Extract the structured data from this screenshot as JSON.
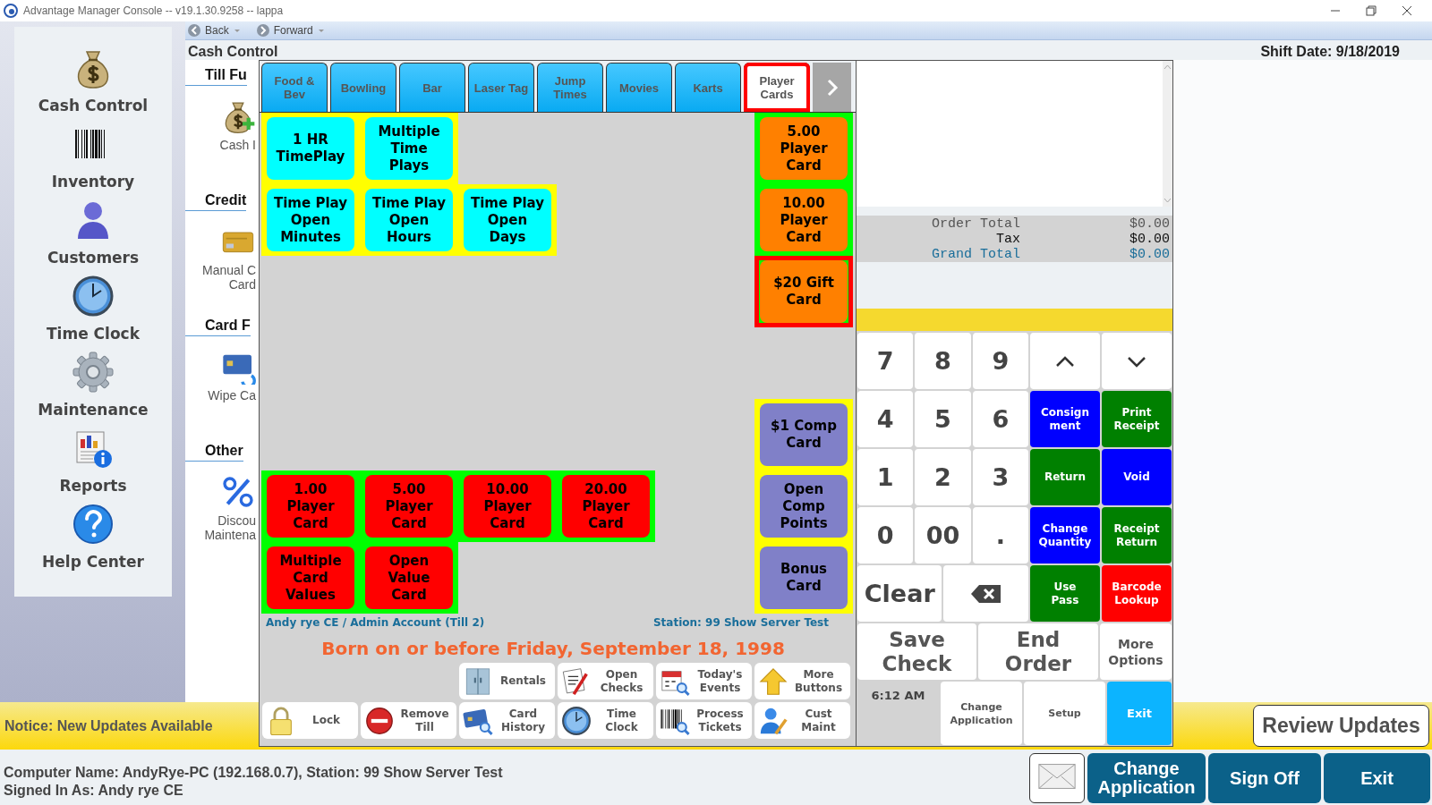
{
  "window": {
    "title": "Advantage Manager Console -- v19.1.30.9258 -- lappa"
  },
  "sidebar": {
    "items": [
      {
        "label": "Cash Control"
      },
      {
        "label": "Inventory"
      },
      {
        "label": "Customers"
      },
      {
        "label": "Time Clock"
      },
      {
        "label": "Maintenance"
      },
      {
        "label": "Reports"
      },
      {
        "label": "Help Center"
      }
    ]
  },
  "navigation": {
    "back": "Back",
    "forward": "Forward"
  },
  "page": {
    "title": "Cash Control",
    "shift_date": "Shift Date: 9/18/2019",
    "sections": [
      {
        "heading": "Till Fu",
        "items": [
          {
            "label": "Cash I"
          }
        ]
      },
      {
        "heading": "Credit",
        "items": [
          {
            "label": "Manual C\nCard"
          }
        ]
      },
      {
        "heading": "Card F",
        "items": [
          {
            "label": "Wipe Ca"
          }
        ]
      },
      {
        "heading": "Other",
        "items": [
          {
            "label": "Discou\nMaintena"
          }
        ]
      }
    ]
  },
  "pos": {
    "tabs": [
      {
        "label": "Food &\nBev",
        "selected": false
      },
      {
        "label": "Bowling",
        "selected": false
      },
      {
        "label": "Bar",
        "selected": false
      },
      {
        "label": "Laser Tag",
        "selected": false
      },
      {
        "label": "Jump\nTimes",
        "selected": false
      },
      {
        "label": "Movies",
        "selected": false
      },
      {
        "label": "Karts",
        "selected": false
      },
      {
        "label": "Player\nCards",
        "selected": true
      }
    ],
    "left_groups": [
      {
        "color": "#ffff00",
        "rows": [
          [
            {
              "label": "1 HR\nTimePlay",
              "color": "#00ffff",
              "outlined": false
            },
            {
              "label": "Multiple\nTime\nPlays",
              "color": "#00ffff",
              "outlined": false
            }
          ],
          [
            {
              "label": "Time Play\nOpen\nMinutes",
              "color": "#00ffff",
              "outlined": false
            },
            {
              "label": "Time Play\nOpen\nHours",
              "color": "#00ffff",
              "outlined": false
            },
            {
              "label": "Time Play\nOpen\nDays",
              "color": "#00ffff",
              "outlined": false
            }
          ]
        ]
      },
      {
        "color": "#00ff00",
        "rows": [
          [
            {
              "label": "1.00\nPlayer\nCard",
              "color": "#ff0000",
              "outlined": false
            },
            {
              "label": "5.00\nPlayer\nCard",
              "color": "#ff0000",
              "outlined": false
            },
            {
              "label": "10.00\nPlayer\nCard",
              "color": "#ff0000",
              "outlined": false
            },
            {
              "label": "20.00\nPlayer\nCard",
              "color": "#ff0000",
              "outlined": false
            }
          ],
          [
            {
              "label": "Multiple\nCard\nValues",
              "color": "#ff0000",
              "outlined": false
            },
            {
              "label": "Open\nValue\nCard",
              "color": "#ff0000",
              "outlined": false
            }
          ]
        ]
      }
    ],
    "right_groups": [
      {
        "color": "#00ff00",
        "buttons": [
          {
            "label": "5.00\nPlayer\nCard",
            "color": "#ff8000",
            "outlined": false
          },
          {
            "label": "10.00\nPlayer\nCard",
            "color": "#ff8000",
            "outlined": false
          },
          {
            "label": "$20 Gift\nCard",
            "color": "#ff8000",
            "outlined": true
          }
        ]
      },
      {
        "color": "#ffff00",
        "buttons": [
          {
            "label": "$1 Comp\nCard",
            "color": "#8080c8",
            "outlined": false
          },
          {
            "label": "Open\nComp\nPoints",
            "color": "#8080c8",
            "outlined": false
          },
          {
            "label": "Bonus\nCard",
            "color": "#8080c8",
            "outlined": false
          }
        ]
      }
    ],
    "operator": "Andy rye CE / Admin Account (Till 2)",
    "station": "Station: 99 Show Server Test",
    "age_notice": "Born on or before Friday, September 18, 1998",
    "toolbar": [
      [
        {
          "label": "Rentals"
        },
        {
          "label": "Open\nChecks"
        },
        {
          "label": "Today's\nEvents"
        },
        {
          "label": "More\nButtons"
        }
      ],
      [
        {
          "label": "Lock"
        },
        {
          "label": "Remove\nTill"
        },
        {
          "label": "Card\nHistory"
        },
        {
          "label": "Time\nClock"
        },
        {
          "label": "Process\nTickets"
        },
        {
          "label": "Cust\nMaint"
        }
      ]
    ],
    "totals": [
      {
        "label": "Order Total",
        "value": "$0.00",
        "kind": "subtotal"
      },
      {
        "label": "Tax",
        "value": "$0.00",
        "kind": "tax"
      },
      {
        "label": "Grand Total",
        "value": "$0.00",
        "kind": "grand"
      }
    ],
    "keypad": [
      {
        "label": "7",
        "kind": "digit"
      },
      {
        "label": "8",
        "kind": "digit"
      },
      {
        "label": "9",
        "kind": "digit"
      },
      {
        "kind": "up"
      },
      {
        "kind": "down"
      },
      {
        "label": "4",
        "kind": "digit"
      },
      {
        "label": "5",
        "kind": "digit"
      },
      {
        "label": "6",
        "kind": "digit"
      },
      {
        "label": "Consign\nment",
        "kind": "action",
        "color": "#0000ff"
      },
      {
        "label": "Print\nReceipt",
        "kind": "action",
        "color": "#008000"
      },
      {
        "label": "1",
        "kind": "digit"
      },
      {
        "label": "2",
        "kind": "digit"
      },
      {
        "label": "3",
        "kind": "digit"
      },
      {
        "label": "Return",
        "kind": "action",
        "color": "#008000"
      },
      {
        "label": "Void",
        "kind": "action",
        "color": "#0000ff"
      },
      {
        "label": "0",
        "kind": "digit"
      },
      {
        "label": "00",
        "kind": "digit"
      },
      {
        "label": ".",
        "kind": "digit"
      },
      {
        "label": "Change\nQuantity",
        "kind": "action",
        "color": "#0000ff"
      },
      {
        "label": "Receipt\nReturn",
        "kind": "action",
        "color": "#008000"
      },
      {
        "label": "Clear",
        "kind": "wide"
      },
      {
        "kind": "backspace"
      },
      {
        "label": "Use\nPass",
        "kind": "action",
        "color": "#008000"
      },
      {
        "label": "Barcode\nLookup",
        "kind": "action",
        "color": "#ff0000"
      }
    ],
    "order_actions": [
      {
        "label": "Save\nCheck",
        "kind": "large"
      },
      {
        "label": "End\nOrder",
        "kind": "large"
      },
      {
        "label": "More\nOptions",
        "kind": "small"
      }
    ],
    "clock": "6:12 AM",
    "footer_buttons": [
      {
        "label": "Change\nApplication",
        "kind": "plain"
      },
      {
        "label": "Setup",
        "kind": "plain"
      },
      {
        "label": "Exit",
        "kind": "primary"
      }
    ]
  },
  "notice": {
    "text": "Notice: New Updates Available",
    "button": "Review Updates"
  },
  "status_bar": {
    "lines": [
      "Computer Name: AndyRye-PC (192.168.0.7), Station: 99 Show Server Test",
      "Signed In As: Andy rye CE"
    ],
    "buttons": [
      {
        "kind": "mail"
      },
      {
        "label": "Change\nApplication",
        "kind": "text"
      },
      {
        "label": "Sign Off",
        "kind": "text"
      },
      {
        "label": "Exit",
        "kind": "text"
      }
    ]
  }
}
